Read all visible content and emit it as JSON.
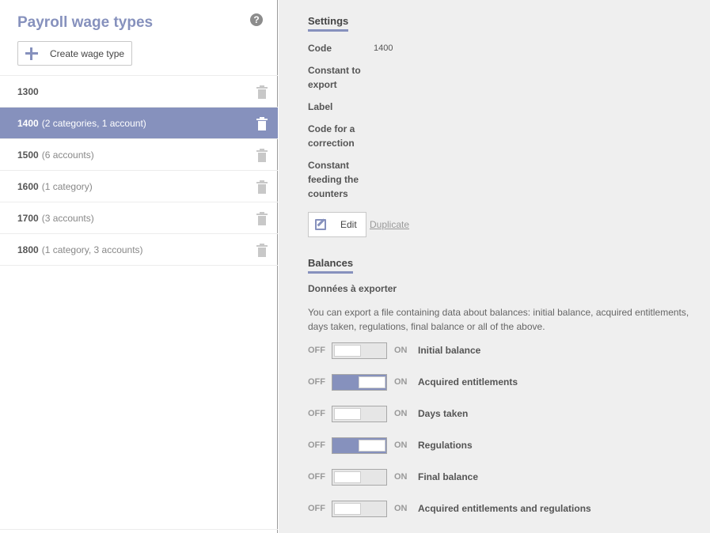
{
  "sidebar": {
    "title": "Payroll wage types",
    "help_glyph": "?",
    "create_button_label": "Create wage type",
    "items": [
      {
        "code": "1300",
        "desc": "",
        "selected": false
      },
      {
        "code": "1400",
        "desc": "(2 categories, 1 account)",
        "selected": true
      },
      {
        "code": "1500",
        "desc": "(6 accounts)",
        "selected": false
      },
      {
        "code": "1600",
        "desc": "(1 category)",
        "selected": false
      },
      {
        "code": "1700",
        "desc": "(3 accounts)",
        "selected": false
      },
      {
        "code": "1800",
        "desc": "(1 category, 3 accounts)",
        "selected": false
      }
    ]
  },
  "settings": {
    "title": "Settings",
    "fields": [
      {
        "label": "Code",
        "value": "1400"
      },
      {
        "label": "Constant to export",
        "value": ""
      },
      {
        "label": "Label",
        "value": ""
      },
      {
        "label": "Code for a correction",
        "value": ""
      },
      {
        "label": "Constant feeding the counters",
        "value": ""
      }
    ],
    "edit_label": "Edit",
    "duplicate_label": "Duplicate"
  },
  "balances": {
    "title": "Balances",
    "subheading": "Données à exporter",
    "description": "You can export a file containing data about balances: initial balance, acquired entitlements, days taken, regulations, final balance or all of the above.",
    "off_label": "OFF",
    "on_label": "ON",
    "toggles": [
      {
        "label": "Initial balance",
        "on": false
      },
      {
        "label": "Acquired entitlements",
        "on": true
      },
      {
        "label": "Days taken",
        "on": false
      },
      {
        "label": "Regulations",
        "on": true
      },
      {
        "label": "Final balance",
        "on": false
      },
      {
        "label": "Acquired entitlements and regulations",
        "on": false
      }
    ]
  },
  "colors": {
    "accent": "#8691bd",
    "panel_bg": "#efefef"
  }
}
